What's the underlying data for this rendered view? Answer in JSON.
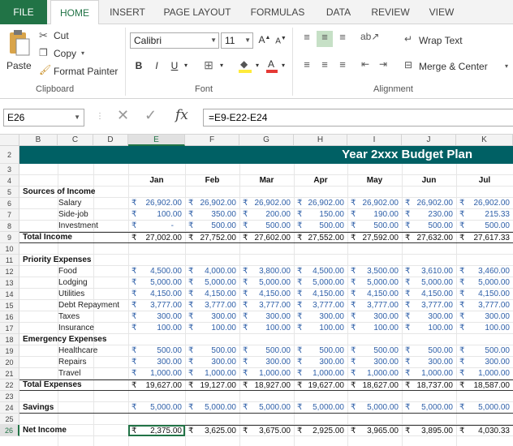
{
  "tabs": [
    "FILE",
    "HOME",
    "INSERT",
    "PAGE LAYOUT",
    "FORMULAS",
    "DATA",
    "REVIEW",
    "VIEW"
  ],
  "clipboard": {
    "paste": "Paste",
    "cut": "Cut",
    "copy": "Copy",
    "format_painter": "Format Painter",
    "group": "Clipboard"
  },
  "font": {
    "name": "Calibri",
    "size": "11",
    "bold": "B",
    "italic": "I",
    "underline": "U",
    "group": "Font"
  },
  "alignment": {
    "wrap": "Wrap Text",
    "merge": "Merge & Center",
    "group": "Alignment"
  },
  "namebox": "E26",
  "fx": "fx",
  "formula": "=E9-E22-E24",
  "columns": [
    "B",
    "C",
    "D",
    "E",
    "F",
    "G",
    "H",
    "I",
    "J",
    "K"
  ],
  "title": "Year 2xxx Budget Plan",
  "months": [
    "Jan",
    "Feb",
    "Mar",
    "Apr",
    "May",
    "Jun",
    "Jul"
  ],
  "currency": "₹",
  "rows": [
    {
      "n": "2",
      "kind": "title"
    },
    {
      "n": "3",
      "kind": "blank"
    },
    {
      "n": "4",
      "kind": "months"
    },
    {
      "n": "5",
      "kind": "section",
      "label": "Sources of Income"
    },
    {
      "n": "6",
      "kind": "item",
      "label": "Salary",
      "values": [
        "26,902.00",
        "26,902.00",
        "26,902.00",
        "26,902.00",
        "26,902.00",
        "26,902.00",
        "26,902.00"
      ]
    },
    {
      "n": "7",
      "kind": "item",
      "label": "Side-job",
      "values": [
        "100.00",
        "350.00",
        "200.00",
        "150.00",
        "190.00",
        "230.00",
        "215.33"
      ]
    },
    {
      "n": "8",
      "kind": "item",
      "label": "Investment",
      "values": [
        "-",
        "500.00",
        "500.00",
        "500.00",
        "500.00",
        "500.00",
        "500.00"
      ]
    },
    {
      "n": "9",
      "kind": "total",
      "label": "Total Income",
      "values": [
        "27,002.00",
        "27,752.00",
        "27,602.00",
        "27,552.00",
        "27,592.00",
        "27,632.00",
        "27,617.33"
      ]
    },
    {
      "n": "10",
      "kind": "blank"
    },
    {
      "n": "11",
      "kind": "section",
      "label": "Priority Expenses"
    },
    {
      "n": "12",
      "kind": "item",
      "label": "Food",
      "values": [
        "4,500.00",
        "4,000.00",
        "3,800.00",
        "4,500.00",
        "3,500.00",
        "3,610.00",
        "3,460.00"
      ]
    },
    {
      "n": "13",
      "kind": "item",
      "label": "Lodging",
      "values": [
        "5,000.00",
        "5,000.00",
        "5,000.00",
        "5,000.00",
        "5,000.00",
        "5,000.00",
        "5,000.00"
      ]
    },
    {
      "n": "14",
      "kind": "item",
      "label": "Utilities",
      "values": [
        "4,150.00",
        "4,150.00",
        "4,150.00",
        "4,150.00",
        "4,150.00",
        "4,150.00",
        "4,150.00"
      ]
    },
    {
      "n": "15",
      "kind": "item",
      "label": "Debt Repayment",
      "values": [
        "3,777.00",
        "3,777.00",
        "3,777.00",
        "3,777.00",
        "3,777.00",
        "3,777.00",
        "3,777.00"
      ]
    },
    {
      "n": "16",
      "kind": "item",
      "label": "Taxes",
      "values": [
        "300.00",
        "300.00",
        "300.00",
        "300.00",
        "300.00",
        "300.00",
        "300.00"
      ]
    },
    {
      "n": "17",
      "kind": "item",
      "label": "Insurance",
      "values": [
        "100.00",
        "100.00",
        "100.00",
        "100.00",
        "100.00",
        "100.00",
        "100.00"
      ]
    },
    {
      "n": "18",
      "kind": "section",
      "label": "Emergency Expenses"
    },
    {
      "n": "19",
      "kind": "item",
      "label": "Healthcare",
      "values": [
        "500.00",
        "500.00",
        "500.00",
        "500.00",
        "500.00",
        "500.00",
        "500.00"
      ]
    },
    {
      "n": "20",
      "kind": "item",
      "label": "Repairs",
      "values": [
        "300.00",
        "300.00",
        "300.00",
        "300.00",
        "300.00",
        "300.00",
        "300.00"
      ]
    },
    {
      "n": "21",
      "kind": "item",
      "label": "Travel",
      "values": [
        "1,000.00",
        "1,000.00",
        "1,000.00",
        "1,000.00",
        "1,000.00",
        "1,000.00",
        "1,000.00"
      ]
    },
    {
      "n": "22",
      "kind": "total",
      "label": "Total Expenses",
      "values": [
        "19,627.00",
        "19,127.00",
        "18,927.00",
        "19,627.00",
        "18,627.00",
        "18,737.00",
        "18,587.00"
      ]
    },
    {
      "n": "23",
      "kind": "blank"
    },
    {
      "n": "24",
      "kind": "savings",
      "label": "Savings",
      "values": [
        "5,000.00",
        "5,000.00",
        "5,000.00",
        "5,000.00",
        "5,000.00",
        "5,000.00",
        "5,000.00"
      ]
    },
    {
      "n": "25",
      "kind": "blank"
    },
    {
      "n": "26",
      "kind": "net",
      "label": "Net Income",
      "values": [
        "2,375.00",
        "3,625.00",
        "3,675.00",
        "2,925.00",
        "3,965.00",
        "3,895.00",
        "4,030.33"
      ]
    }
  ],
  "colors": {
    "title_bg": "#006064",
    "accent": "#217346",
    "number": "#2e5fa8"
  }
}
